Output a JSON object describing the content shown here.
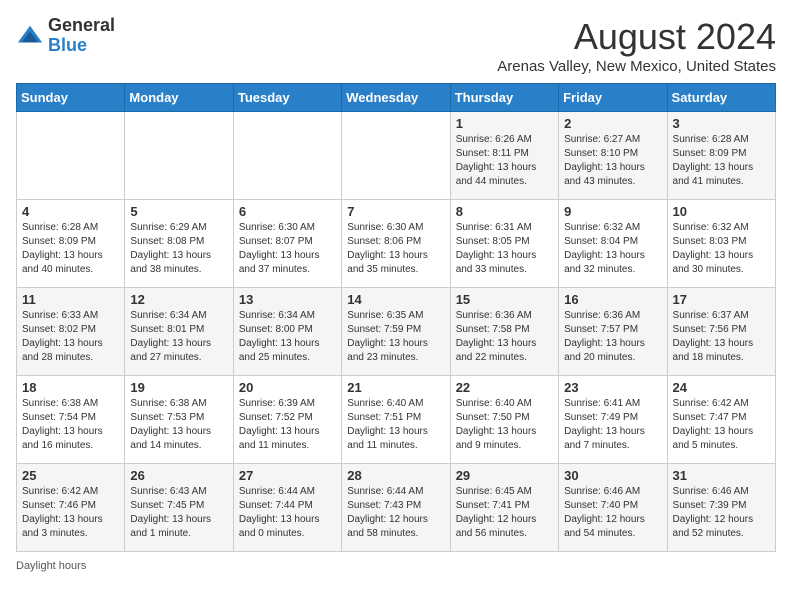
{
  "header": {
    "logo_general": "General",
    "logo_blue": "Blue",
    "month_year": "August 2024",
    "location": "Arenas Valley, New Mexico, United States"
  },
  "days_of_week": [
    "Sunday",
    "Monday",
    "Tuesday",
    "Wednesday",
    "Thursday",
    "Friday",
    "Saturday"
  ],
  "weeks": [
    [
      {
        "day": "",
        "sunrise": "",
        "sunset": "",
        "daylight": ""
      },
      {
        "day": "",
        "sunrise": "",
        "sunset": "",
        "daylight": ""
      },
      {
        "day": "",
        "sunrise": "",
        "sunset": "",
        "daylight": ""
      },
      {
        "day": "",
        "sunrise": "",
        "sunset": "",
        "daylight": ""
      },
      {
        "day": "1",
        "sunrise": "Sunrise: 6:26 AM",
        "sunset": "Sunset: 8:11 PM",
        "daylight": "Daylight: 13 hours and 44 minutes."
      },
      {
        "day": "2",
        "sunrise": "Sunrise: 6:27 AM",
        "sunset": "Sunset: 8:10 PM",
        "daylight": "Daylight: 13 hours and 43 minutes."
      },
      {
        "day": "3",
        "sunrise": "Sunrise: 6:28 AM",
        "sunset": "Sunset: 8:09 PM",
        "daylight": "Daylight: 13 hours and 41 minutes."
      }
    ],
    [
      {
        "day": "4",
        "sunrise": "Sunrise: 6:28 AM",
        "sunset": "Sunset: 8:09 PM",
        "daylight": "Daylight: 13 hours and 40 minutes."
      },
      {
        "day": "5",
        "sunrise": "Sunrise: 6:29 AM",
        "sunset": "Sunset: 8:08 PM",
        "daylight": "Daylight: 13 hours and 38 minutes."
      },
      {
        "day": "6",
        "sunrise": "Sunrise: 6:30 AM",
        "sunset": "Sunset: 8:07 PM",
        "daylight": "Daylight: 13 hours and 37 minutes."
      },
      {
        "day": "7",
        "sunrise": "Sunrise: 6:30 AM",
        "sunset": "Sunset: 8:06 PM",
        "daylight": "Daylight: 13 hours and 35 minutes."
      },
      {
        "day": "8",
        "sunrise": "Sunrise: 6:31 AM",
        "sunset": "Sunset: 8:05 PM",
        "daylight": "Daylight: 13 hours and 33 minutes."
      },
      {
        "day": "9",
        "sunrise": "Sunrise: 6:32 AM",
        "sunset": "Sunset: 8:04 PM",
        "daylight": "Daylight: 13 hours and 32 minutes."
      },
      {
        "day": "10",
        "sunrise": "Sunrise: 6:32 AM",
        "sunset": "Sunset: 8:03 PM",
        "daylight": "Daylight: 13 hours and 30 minutes."
      }
    ],
    [
      {
        "day": "11",
        "sunrise": "Sunrise: 6:33 AM",
        "sunset": "Sunset: 8:02 PM",
        "daylight": "Daylight: 13 hours and 28 minutes."
      },
      {
        "day": "12",
        "sunrise": "Sunrise: 6:34 AM",
        "sunset": "Sunset: 8:01 PM",
        "daylight": "Daylight: 13 hours and 27 minutes."
      },
      {
        "day": "13",
        "sunrise": "Sunrise: 6:34 AM",
        "sunset": "Sunset: 8:00 PM",
        "daylight": "Daylight: 13 hours and 25 minutes."
      },
      {
        "day": "14",
        "sunrise": "Sunrise: 6:35 AM",
        "sunset": "Sunset: 7:59 PM",
        "daylight": "Daylight: 13 hours and 23 minutes."
      },
      {
        "day": "15",
        "sunrise": "Sunrise: 6:36 AM",
        "sunset": "Sunset: 7:58 PM",
        "daylight": "Daylight: 13 hours and 22 minutes."
      },
      {
        "day": "16",
        "sunrise": "Sunrise: 6:36 AM",
        "sunset": "Sunset: 7:57 PM",
        "daylight": "Daylight: 13 hours and 20 minutes."
      },
      {
        "day": "17",
        "sunrise": "Sunrise: 6:37 AM",
        "sunset": "Sunset: 7:56 PM",
        "daylight": "Daylight: 13 hours and 18 minutes."
      }
    ],
    [
      {
        "day": "18",
        "sunrise": "Sunrise: 6:38 AM",
        "sunset": "Sunset: 7:54 PM",
        "daylight": "Daylight: 13 hours and 16 minutes."
      },
      {
        "day": "19",
        "sunrise": "Sunrise: 6:38 AM",
        "sunset": "Sunset: 7:53 PM",
        "daylight": "Daylight: 13 hours and 14 minutes."
      },
      {
        "day": "20",
        "sunrise": "Sunrise: 6:39 AM",
        "sunset": "Sunset: 7:52 PM",
        "daylight": "Daylight: 13 hours and 11 minutes."
      },
      {
        "day": "21",
        "sunrise": "Sunrise: 6:40 AM",
        "sunset": "Sunset: 7:51 PM",
        "daylight": "Daylight: 13 hours and 11 minutes."
      },
      {
        "day": "22",
        "sunrise": "Sunrise: 6:40 AM",
        "sunset": "Sunset: 7:50 PM",
        "daylight": "Daylight: 13 hours and 9 minutes."
      },
      {
        "day": "23",
        "sunrise": "Sunrise: 6:41 AM",
        "sunset": "Sunset: 7:49 PM",
        "daylight": "Daylight: 13 hours and 7 minutes."
      },
      {
        "day": "24",
        "sunrise": "Sunrise: 6:42 AM",
        "sunset": "Sunset: 7:47 PM",
        "daylight": "Daylight: 13 hours and 5 minutes."
      }
    ],
    [
      {
        "day": "25",
        "sunrise": "Sunrise: 6:42 AM",
        "sunset": "Sunset: 7:46 PM",
        "daylight": "Daylight: 13 hours and 3 minutes."
      },
      {
        "day": "26",
        "sunrise": "Sunrise: 6:43 AM",
        "sunset": "Sunset: 7:45 PM",
        "daylight": "Daylight: 13 hours and 1 minute."
      },
      {
        "day": "27",
        "sunrise": "Sunrise: 6:44 AM",
        "sunset": "Sunset: 7:44 PM",
        "daylight": "Daylight: 13 hours and 0 minutes."
      },
      {
        "day": "28",
        "sunrise": "Sunrise: 6:44 AM",
        "sunset": "Sunset: 7:43 PM",
        "daylight": "Daylight: 12 hours and 58 minutes."
      },
      {
        "day": "29",
        "sunrise": "Sunrise: 6:45 AM",
        "sunset": "Sunset: 7:41 PM",
        "daylight": "Daylight: 12 hours and 56 minutes."
      },
      {
        "day": "30",
        "sunrise": "Sunrise: 6:46 AM",
        "sunset": "Sunset: 7:40 PM",
        "daylight": "Daylight: 12 hours and 54 minutes."
      },
      {
        "day": "31",
        "sunrise": "Sunrise: 6:46 AM",
        "sunset": "Sunset: 7:39 PM",
        "daylight": "Daylight: 12 hours and 52 minutes."
      }
    ]
  ],
  "footer": {
    "daylight_label": "Daylight hours"
  }
}
